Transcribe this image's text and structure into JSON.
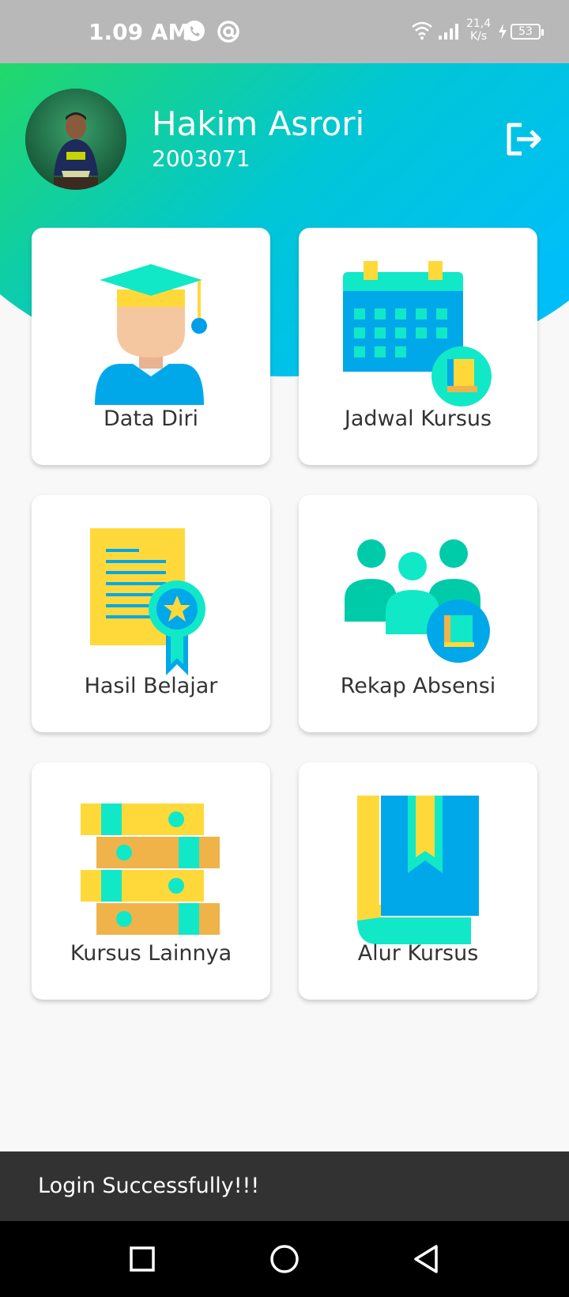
{
  "status_bar": {
    "time": "1.09 AM",
    "net_speed_value": "21,4",
    "net_speed_unit": "K/s",
    "battery": "53",
    "icons": [
      "whatsapp-icon",
      "at-icon",
      "wifi-icon",
      "signal-icon",
      "charging-icon",
      "battery-icon"
    ]
  },
  "header": {
    "user_name": "Hakim Asrori",
    "user_id": "2003071",
    "colors": {
      "gradient_start": "#22d86a",
      "gradient_end": "#00bff8"
    }
  },
  "menu": {
    "items": [
      {
        "label": "Data Diri",
        "icon": "graduate-icon"
      },
      {
        "label": "Jadwal Kursus",
        "icon": "calendar-icon"
      },
      {
        "label": "Hasil Belajar",
        "icon": "certificate-icon"
      },
      {
        "label": "Rekap Absensi",
        "icon": "group-icon"
      },
      {
        "label": "Kursus Lainnya",
        "icon": "books-icon"
      },
      {
        "label": "Alur Kursus",
        "icon": "bookmark-book-icon"
      }
    ]
  },
  "snackbar": {
    "message": "Login Successfully!!!"
  },
  "nav_bar": {
    "buttons": [
      "recents-button",
      "home-button",
      "back-button"
    ]
  }
}
